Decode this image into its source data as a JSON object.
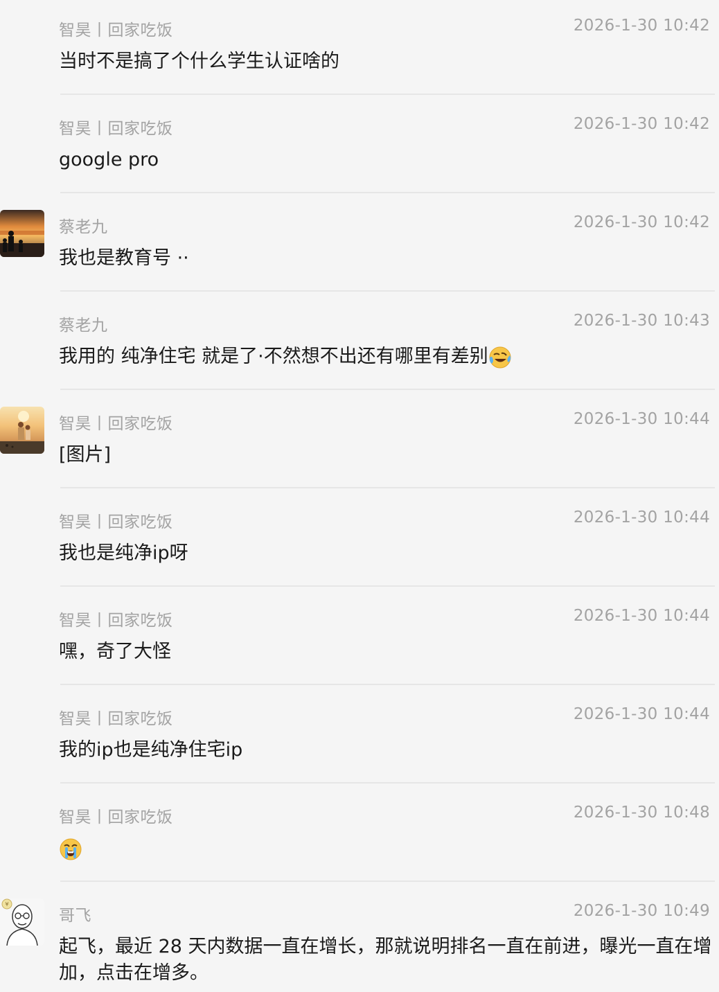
{
  "messages": [
    {
      "sender": "智昊丨回家吃饭",
      "time": "2026-1-30 10:42",
      "text": "当时不是搞了个什么学生认证啥的"
    },
    {
      "sender": "智昊丨回家吃饭",
      "time": "2026-1-30 10:42",
      "text": "google pro"
    },
    {
      "sender": "蔡老九",
      "time": "2026-1-30 10:42",
      "text": "我也是教育号 ··"
    },
    {
      "sender": "蔡老九",
      "time": "2026-1-30 10:43",
      "text": "我用的 纯净住宅 就是了·不然想不出还有哪里有差别",
      "emoji": "laughing-crying-emoji"
    },
    {
      "sender": "智昊丨回家吃饭",
      "time": "2026-1-30 10:44",
      "text": "[图片]"
    },
    {
      "sender": "智昊丨回家吃饭",
      "time": "2026-1-30 10:44",
      "text": "我也是纯净ip呀"
    },
    {
      "sender": "智昊丨回家吃饭",
      "time": "2026-1-30 10:44",
      "text": "嘿，奇了大怪"
    },
    {
      "sender": "智昊丨回家吃饭",
      "time": "2026-1-30 10:44",
      "text": "我的ip也是纯净住宅ip"
    },
    {
      "sender": "智昊丨回家吃饭",
      "time": "2026-1-30 10:48",
      "text": "",
      "emoji": "crying-face-emoji"
    },
    {
      "sender": "哥飞",
      "time": "2026-1-30 10:49",
      "text": "起飞，最近 28 天内数据一直在增长，那就说明排名一直在前进，曝光一直在增加，点击在增多。"
    }
  ],
  "avatars": {
    "caolaojiu": "sunset-family-avatar",
    "zhihao": "beach-couple-avatar",
    "gefei": "bald-man-sketch-avatar"
  }
}
